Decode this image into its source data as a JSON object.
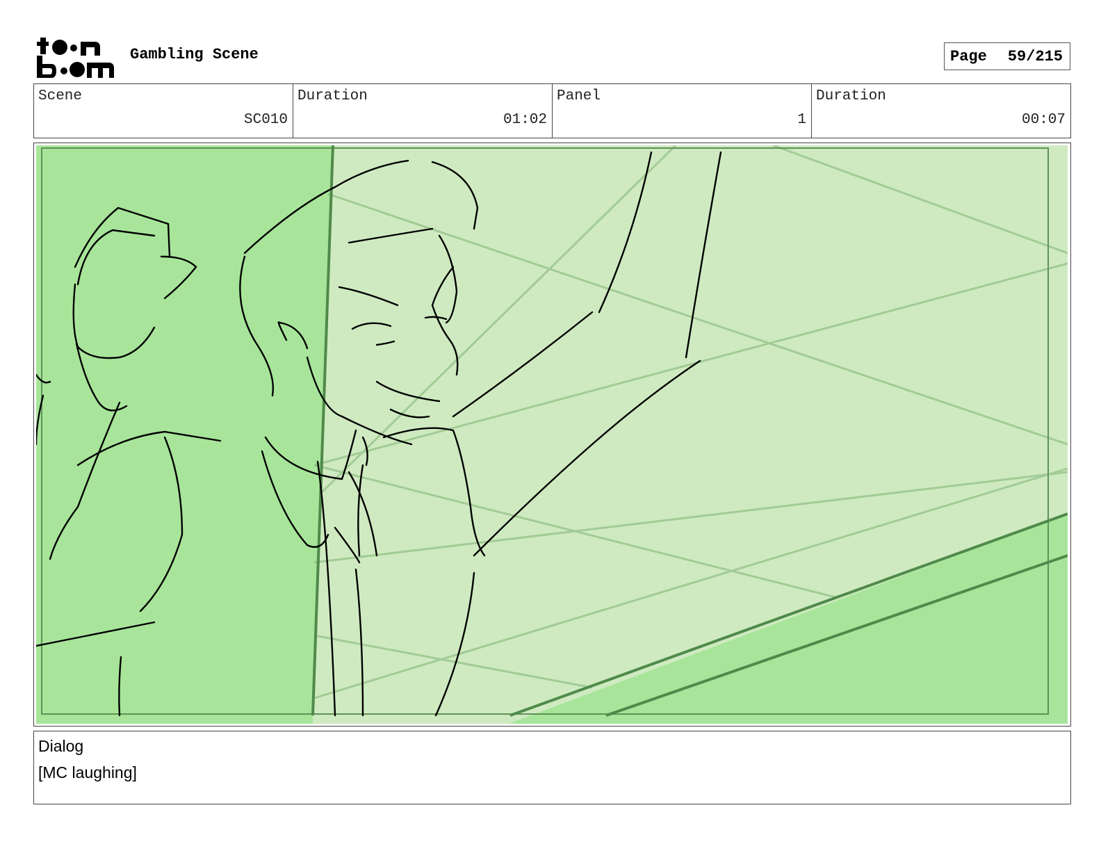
{
  "header": {
    "logo_text": "toon boom",
    "project_title": "Gambling Scene",
    "page_label": "Page",
    "page_value": "59/215"
  },
  "info": [
    {
      "label": "Scene",
      "value": "SC010"
    },
    {
      "label": "Duration",
      "value": "01:02"
    },
    {
      "label": "Panel",
      "value": "1"
    },
    {
      "label": "Duration",
      "value": "00:07"
    }
  ],
  "panel": {
    "colors": {
      "bright_green": "#a8e59a",
      "light_green": "#cfeac0",
      "frame_line": "#4f8a4a",
      "line_art": "#000000"
    }
  },
  "dialog": {
    "label": "Dialog",
    "text": "[MC laughing]"
  }
}
